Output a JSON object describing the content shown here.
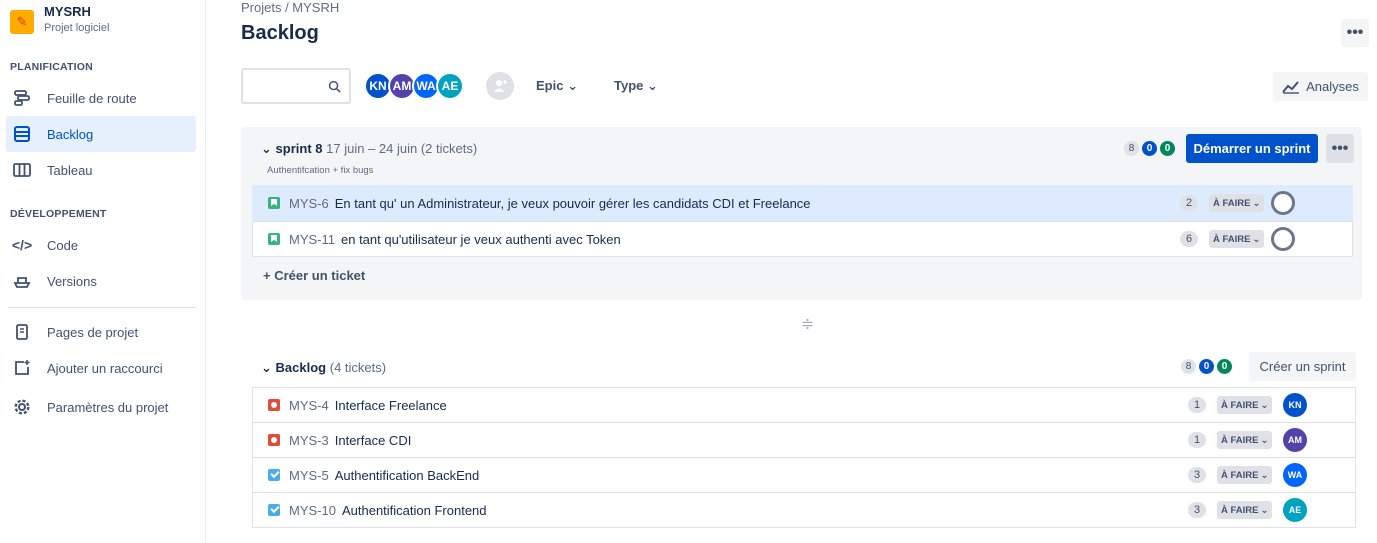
{
  "project": {
    "name": "MYSRH",
    "type": "Projet logiciel"
  },
  "sidebar": {
    "sections": {
      "planning": "PLANIFICATION",
      "dev": "DÉVELOPPEMENT"
    },
    "items": [
      {
        "label": "Feuille de route",
        "icon": "roadmap-icon"
      },
      {
        "label": "Backlog",
        "icon": "backlog-icon",
        "active": true
      },
      {
        "label": "Tableau",
        "icon": "board-icon"
      },
      {
        "label": "Code",
        "icon": "code-icon"
      },
      {
        "label": "Versions",
        "icon": "ship-icon"
      },
      {
        "label": "Pages de projet",
        "icon": "page-icon"
      },
      {
        "label": "Ajouter un raccourci",
        "icon": "add-shortcut-icon"
      },
      {
        "label": "Paramètres du projet",
        "icon": "gear-icon"
      }
    ]
  },
  "header": {
    "breadcrumb": "Projets  /  MYSRH",
    "title": "Backlog",
    "more": "•••"
  },
  "toolbar": {
    "avatars": [
      {
        "initials": "KN",
        "color": "#0052cc"
      },
      {
        "initials": "AM",
        "color": "#5243aa"
      },
      {
        "initials": "WA",
        "color": "#0065ff"
      },
      {
        "initials": "AE",
        "color": "#00a3bf"
      }
    ],
    "epic": "Epic ⌄",
    "type": "Type ⌄",
    "analyses": "Analyses"
  },
  "sprint": {
    "name": "sprint 8",
    "dates": "17 juin – 24 juin",
    "count": "(2 tickets)",
    "goal": "Authentifcation + fix bugs",
    "counts": [
      "8",
      "0",
      "0"
    ],
    "start_label": "Démarrer un sprint",
    "issues": [
      {
        "key": "MYS-6",
        "summary": "En tant qu' un Administrateur, je veux pouvoir gérer les candidats CDI et Freelance",
        "estimate": "2",
        "status": "À FAIRE"
      },
      {
        "key": "MYS-11",
        "summary": "en tant qu'utilisateur je veux authenti avec Token",
        "estimate": "6",
        "status": "À FAIRE"
      }
    ],
    "create_label": "+ Créer un ticket"
  },
  "backlog": {
    "name": "Backlog",
    "count": "(4 tickets)",
    "counts": [
      "8",
      "0",
      "0"
    ],
    "create_sprint_label": "Créer un sprint",
    "issues": [
      {
        "key": "MYS-4",
        "summary": "Interface Freelance",
        "estimate": "1",
        "status": "À FAIRE",
        "assignee": "KN",
        "color": "#0052cc"
      },
      {
        "key": "MYS-3",
        "summary": "Interface CDI",
        "estimate": "1",
        "status": "À FAIRE",
        "assignee": "AM",
        "color": "#5243aa"
      },
      {
        "key": "MYS-5",
        "summary": "Authentification BackEnd",
        "estimate": "3",
        "status": "À FAIRE",
        "assignee": "WA",
        "color": "#0065ff"
      },
      {
        "key": "MYS-10",
        "summary": "Authentification Frontend",
        "estimate": "3",
        "status": "À FAIRE",
        "assignee": "AE",
        "color": "#00a3bf"
      }
    ]
  }
}
